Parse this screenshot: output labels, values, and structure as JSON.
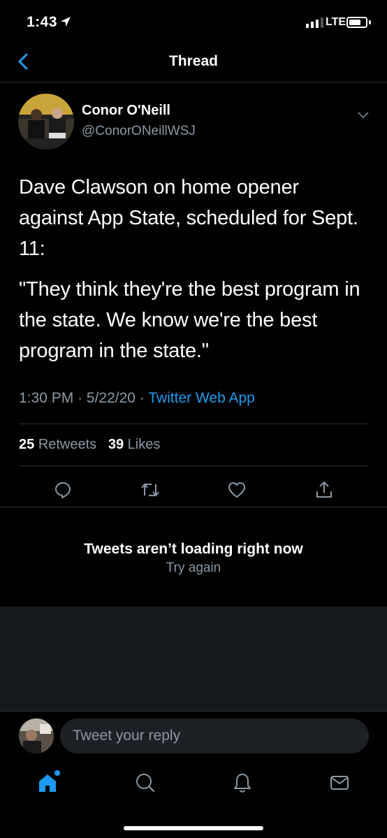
{
  "status_bar": {
    "time": "1:43",
    "network": "LTE"
  },
  "header": {
    "title": "Thread"
  },
  "tweet": {
    "author_name": "Conor O'Neill",
    "author_handle": "@ConorONeillWSJ",
    "paragraphs": [
      "Dave Clawson on home opener against App State, scheduled for Sept. 11:",
      "\"They think they're the best program in the state. We know we're the best program in the state.\""
    ],
    "time": "1:30 PM",
    "date": "5/22/20",
    "separator": "·",
    "source": "Twitter Web App",
    "retweets_count": "25",
    "retweets_label": "Retweets",
    "likes_count": "39",
    "likes_label": "Likes",
    "actions": [
      "reply-icon",
      "retweet-icon",
      "like-icon",
      "share-icon"
    ]
  },
  "error": {
    "title": "Tweets aren’t loading right now",
    "retry": "Try again"
  },
  "reply": {
    "placeholder": "Tweet your reply"
  },
  "tabs": [
    "home-icon",
    "search-icon",
    "notifications-icon",
    "messages-icon"
  ],
  "colors": {
    "accent": "#1d9bf0",
    "muted": "#8b98a5",
    "background": "#000000",
    "divider": "#2f3336"
  }
}
